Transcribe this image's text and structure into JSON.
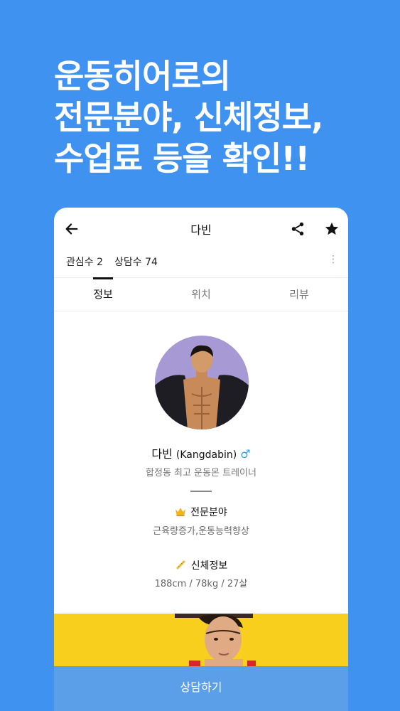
{
  "headline": {
    "line1": "운동히어로의",
    "line2": "전문분야, 신체정보,",
    "line3": "수업료 등을 확인!!"
  },
  "app_bar": {
    "title": "다빈",
    "back_icon": "arrow-left-icon",
    "share_icon": "share-icon",
    "favorite_icon": "star-icon"
  },
  "stats": {
    "interest": "관심수 2",
    "consult": "상담수 74",
    "more_icon": "⋮"
  },
  "tabs": [
    {
      "label": "정보",
      "active": true
    },
    {
      "label": "위치",
      "active": false
    },
    {
      "label": "리뷰",
      "active": false
    }
  ],
  "profile": {
    "name": "다빈",
    "alias": "(Kangdabin)",
    "gender_symbol": "♂",
    "subtitle": "합정동 최고 운동몬 트레이너"
  },
  "specialty": {
    "title": "전문분야",
    "value": "근육량증가,운동능력향상",
    "icon": "crown-icon"
  },
  "body_info": {
    "title": "신체정보",
    "value": "188cm / 78kg / 27살",
    "icon": "ruler-icon"
  },
  "cta": {
    "label": "상담하기"
  },
  "colors": {
    "background": "#3f92ef",
    "cta": "#5a9fe8",
    "banner": "#f7cf1c",
    "gender": "#2fa3e8"
  }
}
